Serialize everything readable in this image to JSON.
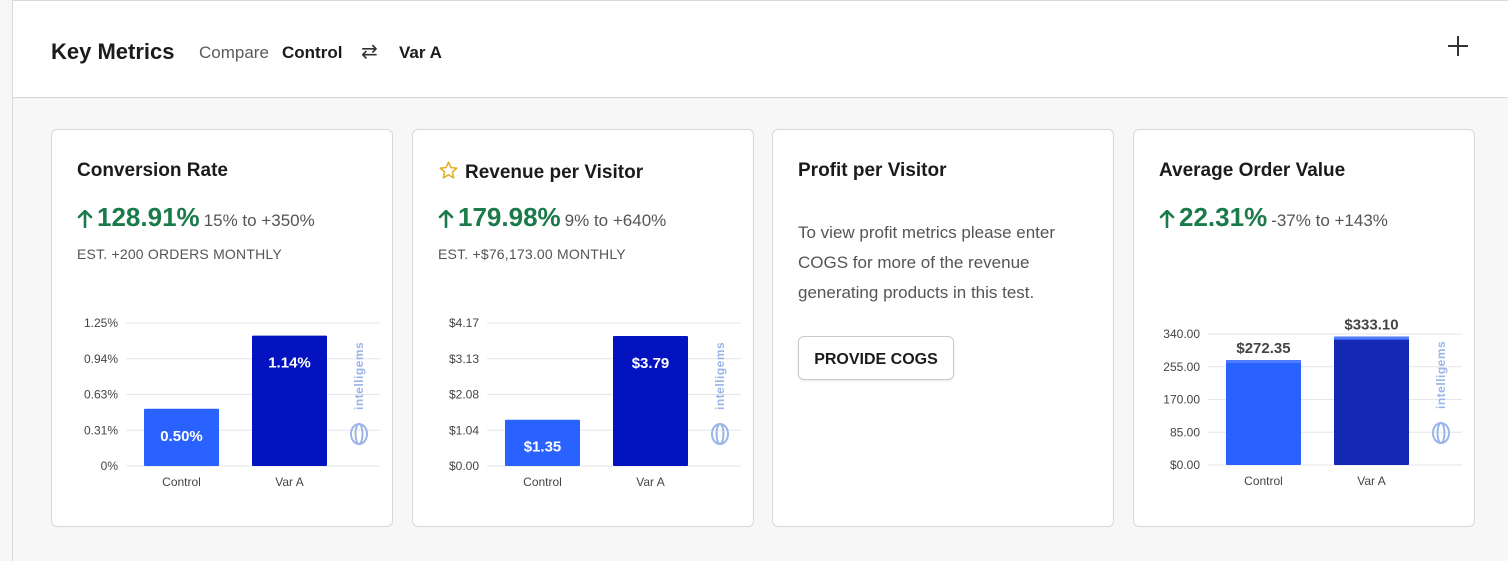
{
  "header": {
    "title": "Key Metrics",
    "compare_label": "Compare",
    "control_label": "Control",
    "swap_icon": "swap-arrows-icon",
    "variant_label": "Var A",
    "add_icon": "plus-icon"
  },
  "cards": {
    "conversion": {
      "title": "Conversion Rate",
      "lift": "128.91%",
      "range": "15% to +350%",
      "estimate": "EST. +200 ORDERS MONTHLY"
    },
    "revenue": {
      "title": "Revenue per Visitor",
      "icon": "star-icon",
      "lift": "179.98%",
      "range": "9% to +640%",
      "estimate": "EST. +$76,173.00 MONTHLY"
    },
    "profit": {
      "title": "Profit per Visitor",
      "message": "To view profit metrics please enter COGS for more of the revenue generating products in this test.",
      "button_label": "PROVIDE COGS"
    },
    "aov": {
      "title": "Average Order Value",
      "lift": "22.31%",
      "range": "-37% to +143%"
    }
  },
  "watermark": "intelligems",
  "colors": {
    "positive": "#1a7a4a",
    "control_bar": "#2962ff",
    "variant_bar": "#0313c0",
    "aov_variant_bar": "#1428b4",
    "star": "#e0b028"
  },
  "chart_data": [
    {
      "type": "bar",
      "categories": [
        "Control",
        "Var A"
      ],
      "values": [
        0.5,
        1.14
      ],
      "data_labels": [
        "0.50%",
        "1.14%"
      ],
      "yticks": [
        "0%",
        "0.31%",
        "0.63%",
        "0.94%",
        "1.25%"
      ],
      "ylim": [
        0,
        1.25
      ]
    },
    {
      "type": "bar",
      "categories": [
        "Control",
        "Var A"
      ],
      "values": [
        1.35,
        3.79
      ],
      "data_labels": [
        "$1.35",
        "$3.79"
      ],
      "yticks": [
        "$0.00",
        "$1.04",
        "$2.08",
        "$3.13",
        "$4.17"
      ],
      "ylim": [
        0,
        4.17
      ]
    },
    {
      "type": "bar",
      "categories": [
        "Control",
        "Var A"
      ],
      "values": [
        272.35,
        333.1
      ],
      "data_labels": [
        "$272.35",
        "$333.10"
      ],
      "yticks": [
        "$0.00",
        "85.00",
        "170.00",
        "255.00",
        "340.00"
      ],
      "ylim": [
        0,
        340
      ]
    }
  ]
}
